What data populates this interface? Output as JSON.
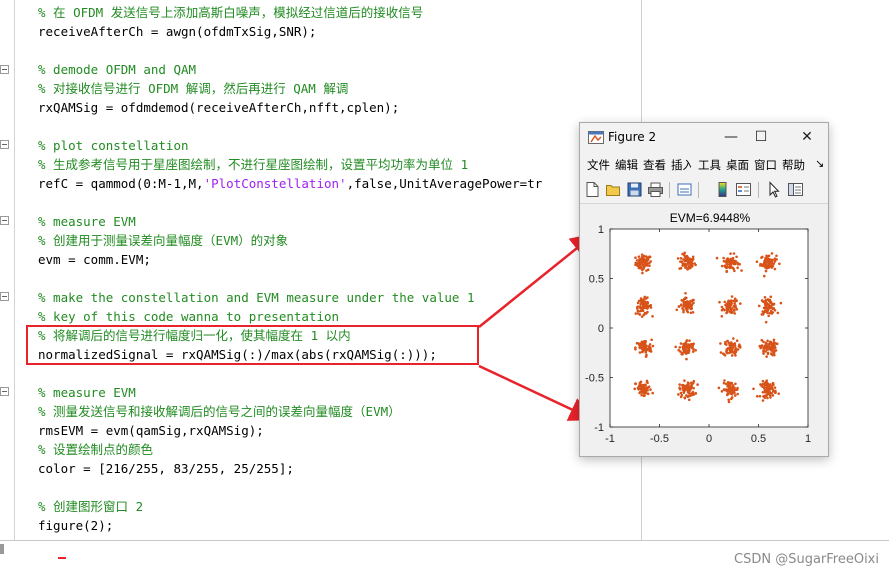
{
  "editor": {
    "lines": [
      {
        "segments": [
          {
            "t": "% 在 OFDM 发送信号上添加高斯白噪声，模拟经过信道后的接收信号",
            "c": "cm"
          }
        ]
      },
      {
        "segments": [
          {
            "t": "receiveAfterCh = awgn(ofdmTxSig,SNR);",
            "c": ""
          }
        ]
      },
      {
        "segments": []
      },
      {
        "segments": [
          {
            "t": "% demode OFDM and QAM",
            "c": "cm"
          }
        ]
      },
      {
        "segments": [
          {
            "t": "% 对接收信号进行 OFDM 解调，然后再进行 QAM 解调",
            "c": "cm"
          }
        ]
      },
      {
        "segments": [
          {
            "t": "rxQAMSig = ofdmdemod(receiveAfterCh,nfft,cplen);",
            "c": ""
          }
        ]
      },
      {
        "segments": []
      },
      {
        "segments": [
          {
            "t": "% plot constellation",
            "c": "cm"
          }
        ]
      },
      {
        "segments": [
          {
            "t": "% 生成参考信号用于星座图绘制，不进行星座图绘制，设置平均功率为单位 1",
            "c": "cm"
          }
        ]
      },
      {
        "segments": [
          {
            "t": "refC = qammod(0:M-1,M,",
            "c": ""
          },
          {
            "t": "'PlotConstellation'",
            "c": "str"
          },
          {
            "t": ",false,UnitAveragePower=tr",
            "c": ""
          }
        ]
      },
      {
        "segments": []
      },
      {
        "segments": [
          {
            "t": "% measure EVM",
            "c": "cm"
          }
        ]
      },
      {
        "segments": [
          {
            "t": "% 创建用于测量误差向量幅度（EVM）的对象",
            "c": "cm"
          }
        ]
      },
      {
        "segments": [
          {
            "t": "evm = comm.EVM;",
            "c": ""
          }
        ]
      },
      {
        "segments": []
      },
      {
        "segments": [
          {
            "t": "% make the constellation and EVM measure under the value 1",
            "c": "cm"
          }
        ]
      },
      {
        "segments": [
          {
            "t": "% key of this code wanna to presentation",
            "c": "cm"
          }
        ]
      },
      {
        "segments": [
          {
            "t": "% 将解调后的信号进行幅度归一化，使其幅度在 1 以内",
            "c": "cm"
          }
        ]
      },
      {
        "segments": [
          {
            "t": "normalizedSignal = rxQAMSig(:)/max(abs(rxQAMSig(:)));",
            "c": ""
          }
        ]
      },
      {
        "segments": []
      },
      {
        "segments": [
          {
            "t": "% measure EVM",
            "c": "cm"
          }
        ]
      },
      {
        "segments": [
          {
            "t": "% 测量发送信号和接收解调后的信号之间的误差向量幅度（EVM）",
            "c": "cm"
          }
        ]
      },
      {
        "segments": [
          {
            "t": "rmsEVM = evm(qamSig,rxQAMSig);",
            "c": ""
          }
        ]
      },
      {
        "segments": [
          {
            "t": "% 设置绘制点的颜色",
            "c": "cm"
          }
        ]
      },
      {
        "segments": [
          {
            "t": "color = [216/255, 83/255, 25/255];",
            "c": ""
          }
        ]
      },
      {
        "segments": []
      },
      {
        "segments": [
          {
            "t": "% 创建图形窗口 2",
            "c": "cm"
          }
        ]
      },
      {
        "segments": [
          {
            "t": "figure(2);",
            "c": ""
          }
        ]
      }
    ],
    "colors": {
      "comment": "#228b22",
      "string": "#a020f0",
      "code": "#000000",
      "highlight_box": "#e8232a"
    }
  },
  "figure_window": {
    "title": "Figure 2",
    "controls": {
      "minimize": "—",
      "maximize": "☐",
      "close": "✕"
    },
    "menu": [
      "文件",
      "编辑",
      "查看",
      "插入",
      "工具",
      "桌面",
      "窗口",
      "帮助",
      "↘"
    ],
    "toolbar_icons": [
      "new-file-icon",
      "open-folder-icon",
      "save-icon",
      "print-icon",
      "link-icon",
      "colorbar-icon",
      "legend-icon",
      "pointer-icon",
      "property-editor-icon"
    ]
  },
  "chart_data": {
    "type": "scatter",
    "title": "EVM=6.9448%",
    "xlabel": "",
    "ylabel": "",
    "xlim": [
      -1,
      1
    ],
    "ylim": [
      -1,
      1
    ],
    "xticks": [
      "-1",
      "-0.5",
      "0",
      "0.5",
      "1"
    ],
    "yticks": [
      "1",
      "0.5",
      "0",
      "-0.5",
      "-1"
    ],
    "marker_color": "#d85319",
    "cluster_spread": 0.04,
    "clusters": [
      {
        "x": -0.66,
        "y": 0.66
      },
      {
        "x": -0.22,
        "y": 0.66
      },
      {
        "x": 0.22,
        "y": 0.66
      },
      {
        "x": 0.6,
        "y": 0.66
      },
      {
        "x": -0.66,
        "y": 0.22
      },
      {
        "x": -0.22,
        "y": 0.22
      },
      {
        "x": 0.22,
        "y": 0.22
      },
      {
        "x": 0.6,
        "y": 0.22
      },
      {
        "x": -0.66,
        "y": -0.2
      },
      {
        "x": -0.22,
        "y": -0.2
      },
      {
        "x": 0.22,
        "y": -0.2
      },
      {
        "x": 0.6,
        "y": -0.2
      },
      {
        "x": -0.66,
        "y": -0.62
      },
      {
        "x": -0.22,
        "y": -0.62
      },
      {
        "x": 0.22,
        "y": -0.62
      },
      {
        "x": 0.6,
        "y": -0.62
      }
    ]
  },
  "watermark": "CSDN @SugarFreeOixi"
}
